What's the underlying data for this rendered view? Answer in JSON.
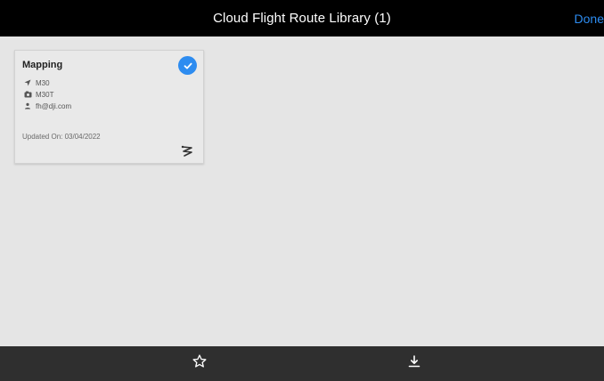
{
  "header": {
    "title": "Cloud Flight Route Library (1)",
    "done_label": "Done",
    "accent_color": "#2d8cf0"
  },
  "routes": [
    {
      "name": "Mapping",
      "selected": true,
      "aircraft": "M30",
      "payload": "M30T",
      "user": "fh@dji.com",
      "updated": "Updated On: 03/04/2022",
      "icons": {
        "aircraft": "navigation-arrow-icon",
        "payload": "camera-icon",
        "user": "user-icon",
        "type": "route-path-icon"
      }
    }
  ],
  "toolbar": {
    "favorite_icon": "star-outline-icon",
    "download_icon": "download-icon"
  }
}
